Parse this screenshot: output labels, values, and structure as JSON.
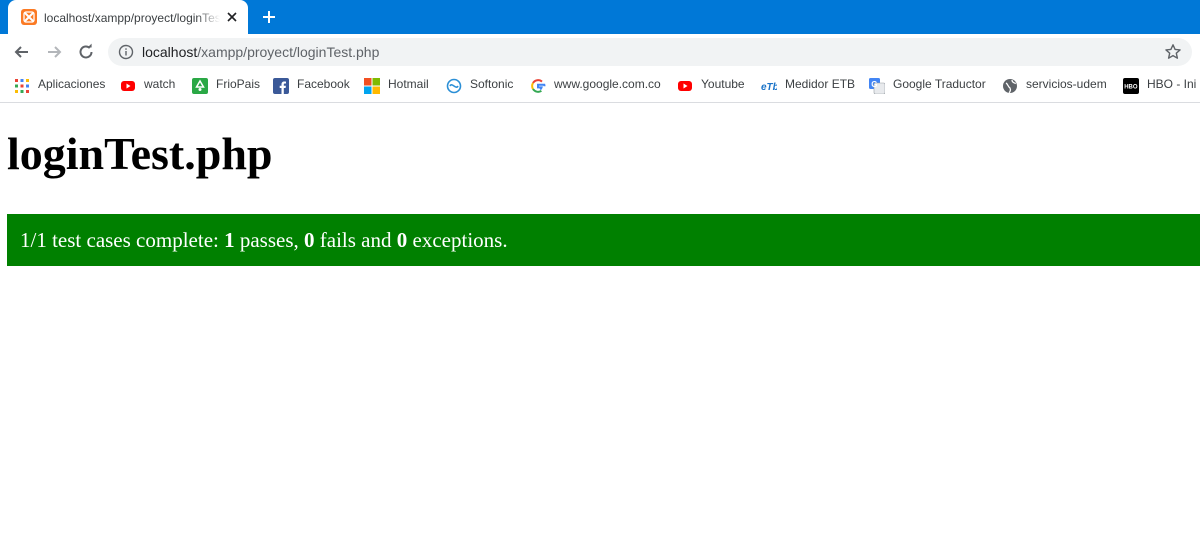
{
  "tab": {
    "title": "localhost/xampp/proyect/loginTest.php",
    "favicon": "xampp-icon",
    "favicon_color": "#fb7a24"
  },
  "chrome": {
    "frame_color": "#0078d7"
  },
  "omnibox": {
    "host": "localhost",
    "path": "/xampp/proyect/loginTest.php"
  },
  "bookmarks": [
    {
      "label": "Aplicaciones",
      "icon": "apps-grid-icon"
    },
    {
      "label": "watch",
      "icon": "youtube-icon"
    },
    {
      "label": "FrioPais",
      "icon": "recycle-icon"
    },
    {
      "label": "Facebook",
      "icon": "facebook-icon"
    },
    {
      "label": "Hotmail",
      "icon": "microsoft-icon"
    },
    {
      "label": "Softonic",
      "icon": "softonic-icon"
    },
    {
      "label": "www.google.com.co",
      "icon": "google-icon"
    },
    {
      "label": "Youtube",
      "icon": "youtube-icon"
    },
    {
      "label": "Medidor ETB",
      "icon": "etb-icon"
    },
    {
      "label": "Google Traductor",
      "icon": "google-translate-icon"
    },
    {
      "label": "servicios-udem",
      "icon": "globe-icon"
    },
    {
      "label": "HBO - Ini",
      "icon": "hbo-icon"
    }
  ],
  "page": {
    "title": "loginTest.php",
    "result": {
      "prefix": "1/1 test cases complete: ",
      "passes": "1",
      "passes_label": " passes, ",
      "fails": "0",
      "fails_label": " fails and ",
      "exceptions": "0",
      "exceptions_label": " exceptions.",
      "color": "#008000"
    }
  }
}
